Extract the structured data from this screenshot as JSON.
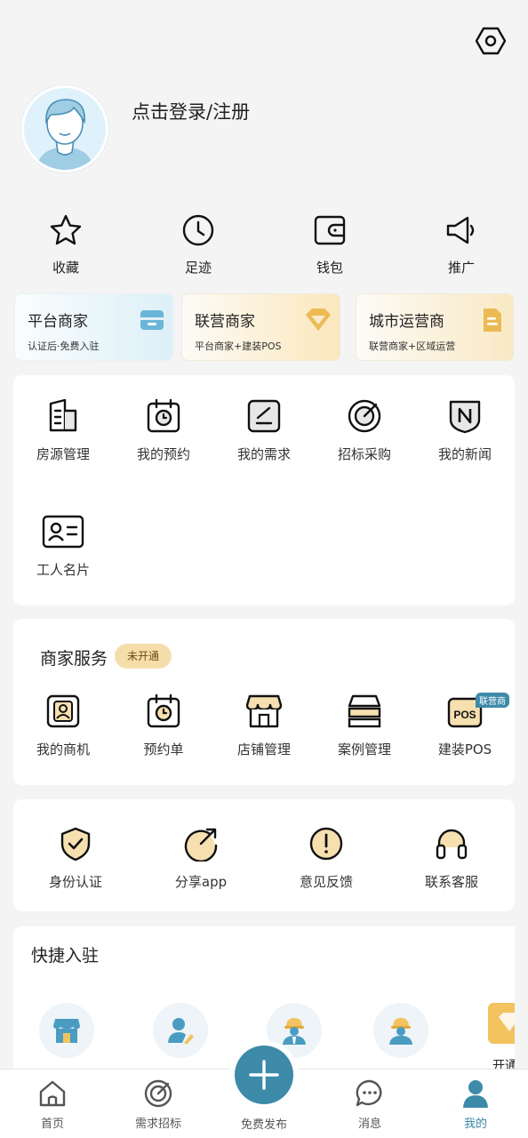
{
  "header": {
    "login_text": "点击登录/注册",
    "settings_icon": "hexagon-settings-icon",
    "avatar_icon": "default-avatar-icon"
  },
  "quick_actions": [
    {
      "label": "收藏",
      "icon": "star-icon"
    },
    {
      "label": "足迹",
      "icon": "clock-icon"
    },
    {
      "label": "钱包",
      "icon": "wallet-icon"
    },
    {
      "label": "推广",
      "icon": "megaphone-icon"
    }
  ],
  "roles": [
    {
      "title": "平台商家",
      "subtitle": "认证后·免费入驻",
      "icon": "shop-icon",
      "gradient": [
        "#f7fcfe",
        "#dff1f7"
      ]
    },
    {
      "title": "联营商家",
      "subtitle": "平台商家+建装POS",
      "icon": "diamond-icon",
      "gradient": [
        "#fbfaf4",
        "#fbe9c3"
      ]
    },
    {
      "title": "城市运营商",
      "subtitle": "联营商家+区域运营",
      "icon": "document-icon",
      "gradient": [
        "#fbfaf5",
        "#faecc9"
      ]
    }
  ],
  "tools": [
    {
      "label": "房源管理",
      "icon": "building-icon"
    },
    {
      "label": "我的预约",
      "icon": "calendar-clock-icon"
    },
    {
      "label": "我的需求",
      "icon": "edit-square-icon"
    },
    {
      "label": "招标采购",
      "icon": "target-icon"
    },
    {
      "label": "我的新闻",
      "icon": "news-n-icon"
    },
    {
      "label": "工人名片",
      "icon": "id-card-icon"
    }
  ],
  "merchant": {
    "title": "商家服务",
    "badge": "未开通",
    "items": [
      {
        "label": "我的商机",
        "icon": "portrait-icon"
      },
      {
        "label": "预约单",
        "icon": "calendar-clock-icon"
      },
      {
        "label": "店铺管理",
        "icon": "store-icon"
      },
      {
        "label": "案例管理",
        "icon": "layers-icon"
      },
      {
        "label": "建装POS",
        "icon": "pos-icon",
        "tag": "联营商"
      }
    ]
  },
  "support": [
    {
      "label": "身份认证",
      "icon": "shield-check-icon"
    },
    {
      "label": "分享app",
      "icon": "share-icon"
    },
    {
      "label": "意见反馈",
      "icon": "exclamation-icon"
    },
    {
      "label": "联系客服",
      "icon": "headset-icon"
    }
  ],
  "fast_join": {
    "title": "快捷入驻",
    "items": [
      {
        "icon": "store-join-icon"
      },
      {
        "icon": "designer-join-icon"
      },
      {
        "icon": "foreman-join-icon"
      },
      {
        "icon": "worker-join-icon"
      },
      {
        "icon": "diamond-join-icon",
        "label": "开通F"
      }
    ]
  },
  "tabbar": [
    {
      "label": "首页",
      "icon": "home-icon"
    },
    {
      "label": "需求招标",
      "icon": "target-tab-icon"
    },
    {
      "label": "免费发布",
      "icon": "plus-icon"
    },
    {
      "label": "消息",
      "icon": "chat-icon"
    },
    {
      "label": "我的",
      "icon": "user-icon",
      "active": true
    }
  ],
  "colors": {
    "accent": "#3d8aa9",
    "gold": "#e8bd5e",
    "badge_bg": "#f5deaa"
  }
}
